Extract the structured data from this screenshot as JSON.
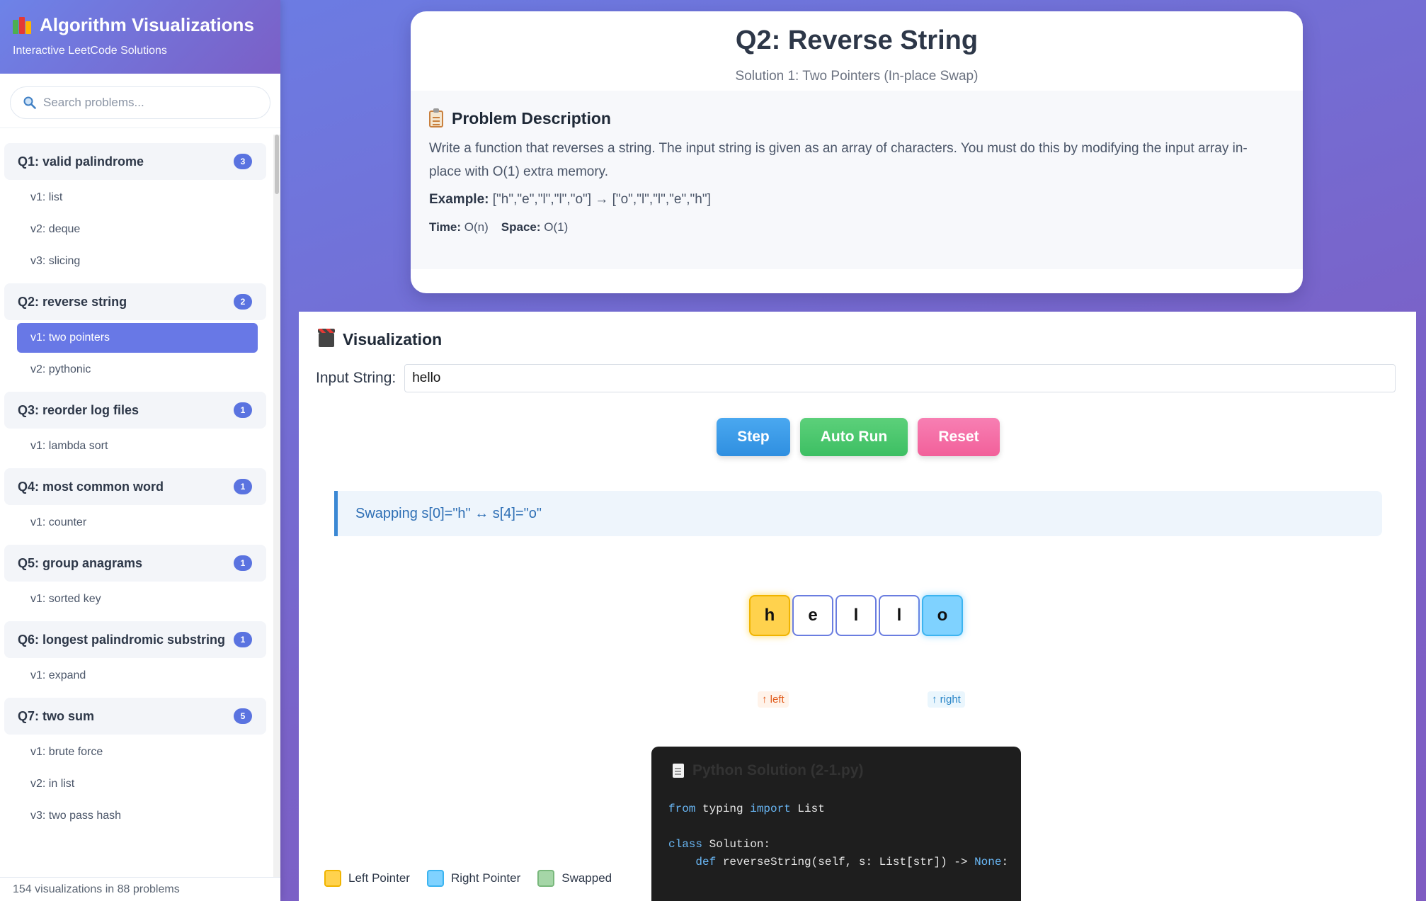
{
  "sidebar": {
    "app_title": "Algorithm Visualizations",
    "app_subtitle": "Interactive LeetCode Solutions",
    "search_placeholder": "Search problems...",
    "footer": "154 visualizations in 88 problems",
    "problems": [
      {
        "title": "Q1: valid palindrome",
        "count": "3",
        "versions": [
          "v1: list",
          "v2: deque",
          "v3: slicing"
        ]
      },
      {
        "title": "Q2: reverse string",
        "count": "2",
        "versions": [
          "v1: two pointers",
          "v2: pythonic"
        ],
        "active_version": 0
      },
      {
        "title": "Q3: reorder log files",
        "count": "1",
        "versions": [
          "v1: lambda sort"
        ]
      },
      {
        "title": "Q4: most common word",
        "count": "1",
        "versions": [
          "v1: counter"
        ]
      },
      {
        "title": "Q5: group anagrams",
        "count": "1",
        "versions": [
          "v1: sorted key"
        ]
      },
      {
        "title": "Q6: longest palindromic substring",
        "count": "1",
        "versions": [
          "v1: expand"
        ]
      },
      {
        "title": "Q7: two sum",
        "count": "5",
        "versions": [
          "v1: brute force",
          "v2: in list",
          "v3: two pass hash"
        ]
      }
    ]
  },
  "problem": {
    "title": "Q2: Reverse String",
    "subtitle": "Solution 1: Two Pointers (In-place Swap)",
    "desc_title": "Problem Description",
    "description": "Write a function that reverses a string. The input string is given as an array of characters. You must do this by modifying the input array in-place with O(1) extra memory.",
    "example_label": "Example:",
    "example_value": "[\"h\",\"e\",\"l\",\"l\",\"o\"] → [\"o\",\"l\",\"l\",\"e\",\"h\"]",
    "time_label": "Time:",
    "time_value": "O(n)",
    "space_label": "Space:",
    "space_value": "O(1)"
  },
  "visualization": {
    "title": "Visualization",
    "input_label": "Input String:",
    "input_value": "hello",
    "buttons": {
      "step": "Step",
      "auto_run": "Auto Run",
      "reset": "Reset"
    },
    "status": "Swapping s[0]=\"h\" ↔ s[4]=\"o\"",
    "array": [
      "h",
      "e",
      "l",
      "l",
      "o"
    ],
    "left_index": 0,
    "right_index": 4,
    "left_pointer_label": "↑ left",
    "right_pointer_label": "↑ right",
    "legend": {
      "left": "Left Pointer",
      "right": "Right Pointer",
      "swapped": "Swapped"
    },
    "colors": {
      "left": "#ffd24d",
      "right": "#7fd2ff",
      "swapped": "#a5d6a7"
    }
  },
  "code": {
    "header": "Python Solution (2-1.py)",
    "lines": [
      {
        "kw": "from",
        "rest": " typing ",
        "kw2": "import",
        "rest2": " List"
      },
      {
        "kw": "",
        "rest": "",
        "kw2": "",
        "rest2": ""
      },
      {
        "kw": "class",
        "rest": " Solution:",
        "kw2": "",
        "rest2": ""
      },
      {
        "kw": "    def",
        "rest": " reverseString(self, s: List[str]) -> ",
        "kw2": "None",
        "rest2": ":"
      }
    ]
  }
}
